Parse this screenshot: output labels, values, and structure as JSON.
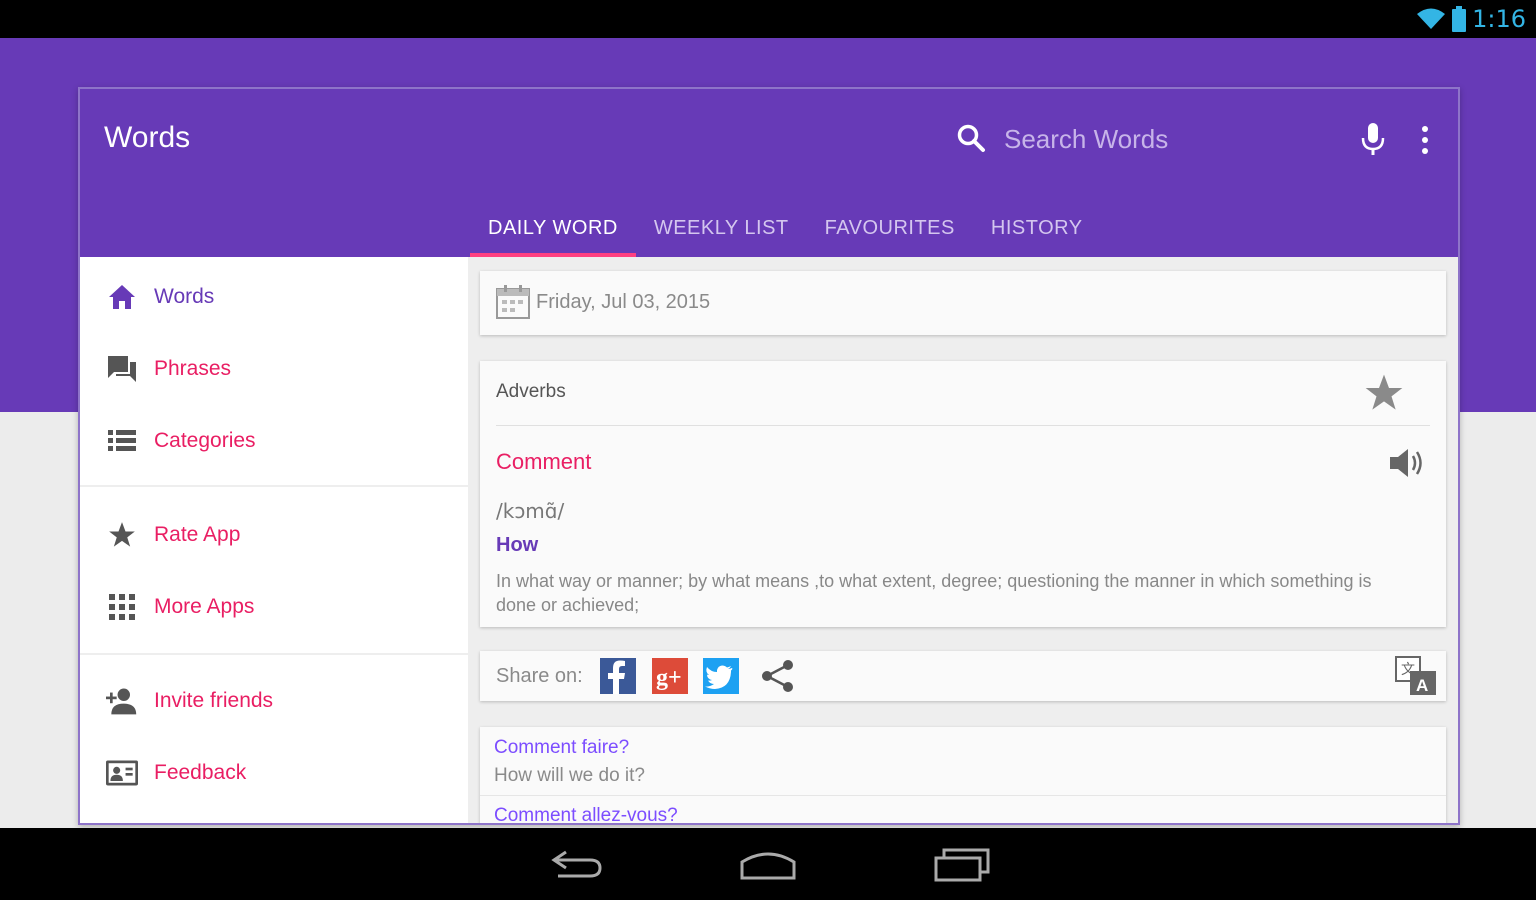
{
  "status_bar": {
    "time": "1:16"
  },
  "app_bar": {
    "title": "Words",
    "search_placeholder": "Search Words",
    "tabs": [
      {
        "label": "DAILY WORD",
        "active": true
      },
      {
        "label": "WEEKLY LIST",
        "active": false
      },
      {
        "label": "FAVOURITES",
        "active": false
      },
      {
        "label": "HISTORY",
        "active": false
      }
    ]
  },
  "sidebar": {
    "items": [
      {
        "label": "Words",
        "icon": "home-icon",
        "current": true
      },
      {
        "label": "Phrases",
        "icon": "chat-icon"
      },
      {
        "label": "Categories",
        "icon": "list-icon"
      },
      {
        "label": "Rate App",
        "icon": "star-icon"
      },
      {
        "label": "More Apps",
        "icon": "apps-grid-icon"
      },
      {
        "label": "Invite friends",
        "icon": "person-add-icon"
      },
      {
        "label": "Feedback",
        "icon": "contact-card-icon"
      }
    ]
  },
  "daily_word": {
    "date": "Friday, Jul 03, 2015",
    "category": "Adverbs",
    "word": "Comment",
    "pronunciation": "/kɔmɑ̃/",
    "meaning_title": "How",
    "definition": "In what way or manner; by what means ,to what extent, degree; questioning the manner in which something is done or achieved;"
  },
  "share": {
    "label": "Share on:",
    "networks": [
      "facebook-icon",
      "google-plus-icon",
      "twitter-icon",
      "share-icon"
    ]
  },
  "phrases": [
    {
      "text": "Comment faire?",
      "translation": "How will we do it?"
    },
    {
      "text": "Comment allez-vous?",
      "translation": ""
    }
  ],
  "colors": {
    "primary": "#673ab7",
    "accent": "#e91e63",
    "tab_indicator": "#ff4081",
    "phrase_link": "#7c4dff"
  }
}
